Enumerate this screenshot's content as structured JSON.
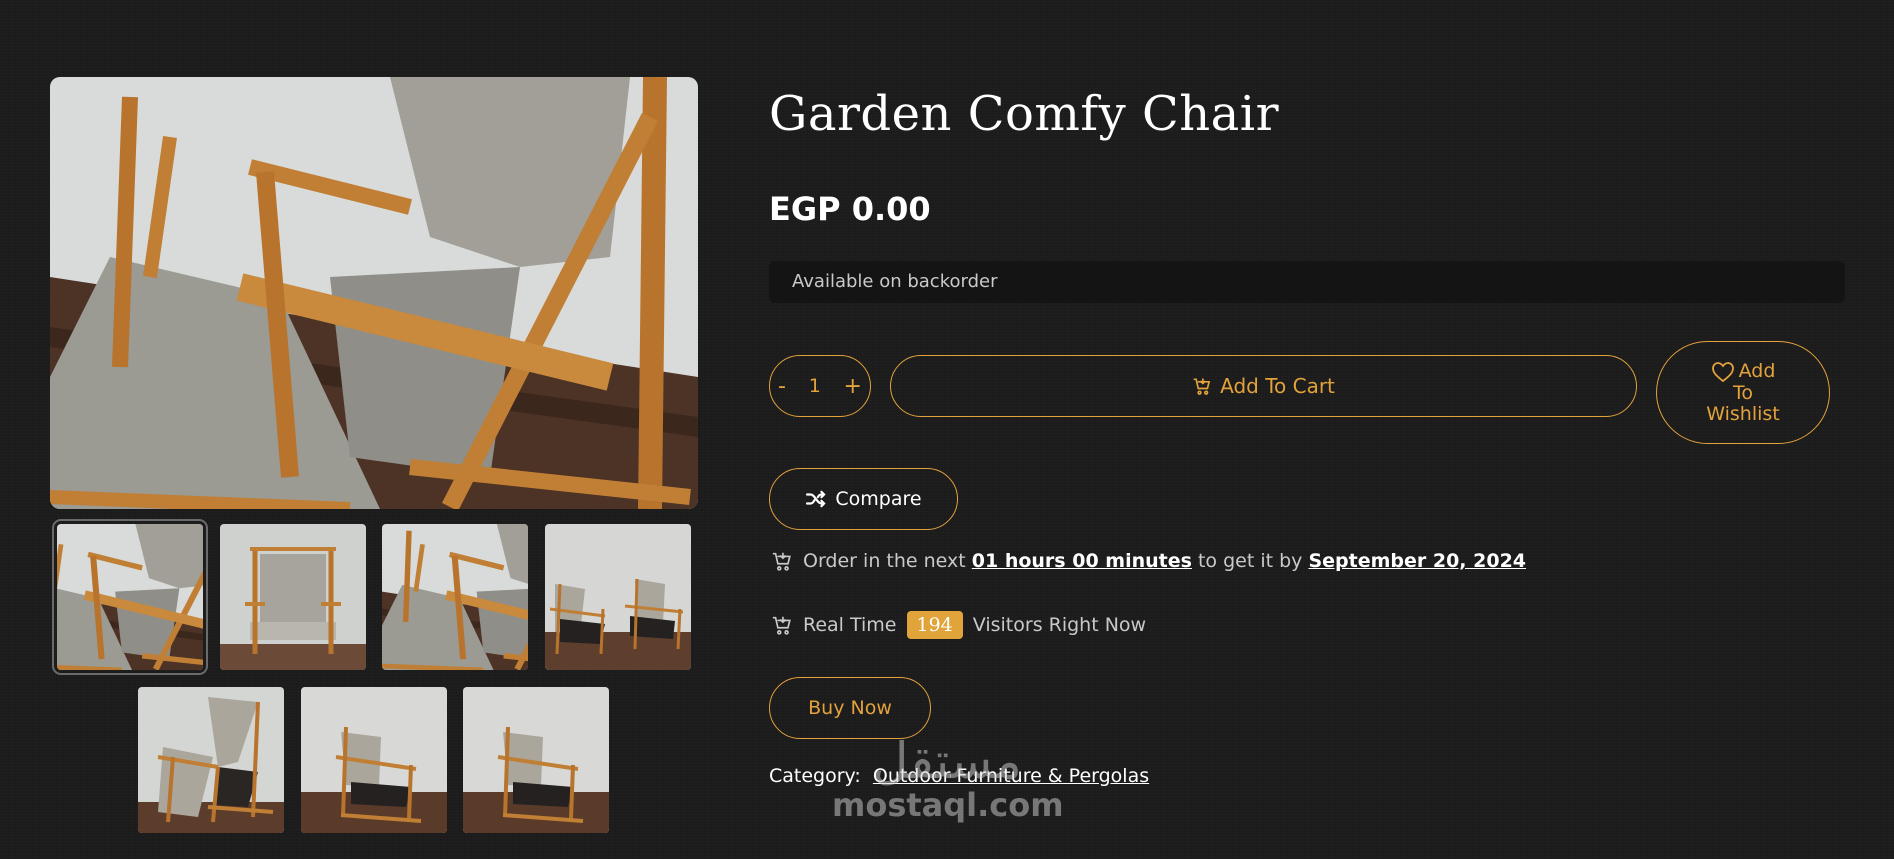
{
  "product": {
    "title": "Garden Comfy Chair",
    "price": "EGP 0.00",
    "stock_status": "Available on backorder",
    "category_label": "Category:",
    "category_value": "Outdoor Furniture & Pergolas"
  },
  "gallery": {
    "main_alt": "Garden Comfy Chair main photo",
    "thumbnail_count": 7,
    "active_thumbnail": 1
  },
  "cart": {
    "qty_minus": "-",
    "qty_value": "1",
    "qty_plus": "+",
    "add_to_cart": "Add To Cart",
    "wishlist_line1": "Add",
    "wishlist_line2": "To",
    "wishlist_line3": "Wishlist",
    "compare": "Compare",
    "buy_now": "Buy Now"
  },
  "delivery": {
    "prefix": "Order in the next",
    "time": "01 hours 00 minutes",
    "middle": "to get it by",
    "date": "September 20, 2024"
  },
  "visitors": {
    "prefix": "Real Time",
    "count": "194",
    "suffix": "Visitors Right Now"
  },
  "watermark": {
    "arabic": "مستقل",
    "latin": "mostaql.com"
  },
  "colors": {
    "background": "#1b1b1b",
    "accent": "#e3a23c",
    "badge": "#e0a43a",
    "stock_bar": "#141414"
  },
  "icons": [
    "cart-icon",
    "heart-icon",
    "shuffle-icon"
  ]
}
